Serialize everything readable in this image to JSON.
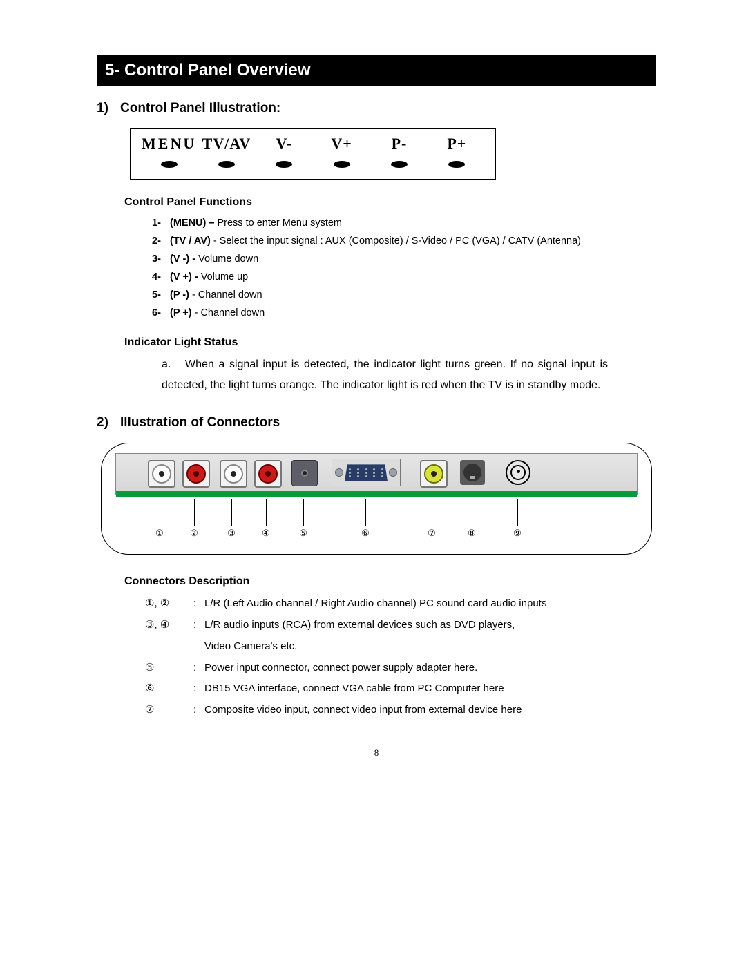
{
  "header": "5- Control Panel Overview",
  "section1": {
    "num": "1)",
    "title": "Control Panel Illustration:"
  },
  "panel": {
    "labels": [
      "MENU",
      "TV/AV",
      "V-",
      "V+",
      "P-",
      "P+"
    ]
  },
  "func_heading": "Control Panel Functions",
  "functions": [
    {
      "n": "1-",
      "key": "(MENU) – ",
      "desc": "Press to enter Menu system"
    },
    {
      "n": "2-",
      "key": "(TV / AV) ",
      "desc": "- Select the input signal : AUX (Composite) / S-Video / PC (VGA) / CATV (Antenna)"
    },
    {
      "n": "3-",
      "key": "(V -) - ",
      "desc": "Volume down"
    },
    {
      "n": "4-",
      "key": "(V +) - ",
      "desc": "Volume up"
    },
    {
      "n": "5-",
      "key": "(P -) ",
      "desc": "- Channel down"
    },
    {
      "n": "6-",
      "key": "(P +) ",
      "desc": "- Channel down"
    }
  ],
  "indicator_heading": "Indicator Light Status",
  "indicator": {
    "a": "a.",
    "text": "When a signal input is detected, the indicator light turns green. If no signal input is detected, the light turns orange. The indicator light is red when the TV is in standby mode."
  },
  "section2": {
    "num": "2)",
    "title": "Illustration of Connectors"
  },
  "conn_labels": [
    "①",
    "②",
    "③",
    "④",
    "⑤",
    "⑥",
    "⑦",
    "⑧",
    "⑨"
  ],
  "conn_desc_heading": "Connectors Description",
  "conn_desc": [
    {
      "sym": "①, ②",
      "colon": ":",
      "text": "L/R (Left Audio channel / Right Audio channel) PC sound card audio inputs"
    },
    {
      "sym": "③, ④",
      "colon": ":",
      "text": "L/R audio inputs (RCA) from external devices such as DVD players,"
    },
    {
      "sym": "",
      "colon": "",
      "text": "Video Camera's etc.",
      "cont": true
    },
    {
      "sym": "⑤",
      "colon": ":",
      "text": "Power input connector, connect power supply adapter here."
    },
    {
      "sym": "⑥",
      "colon": ":",
      "text": "DB15 VGA interface, connect VGA cable from PC Computer here"
    },
    {
      "sym": "⑦",
      "colon": ":",
      "text": "Composite video input, connect video input from external device here"
    }
  ],
  "page_number": "8"
}
